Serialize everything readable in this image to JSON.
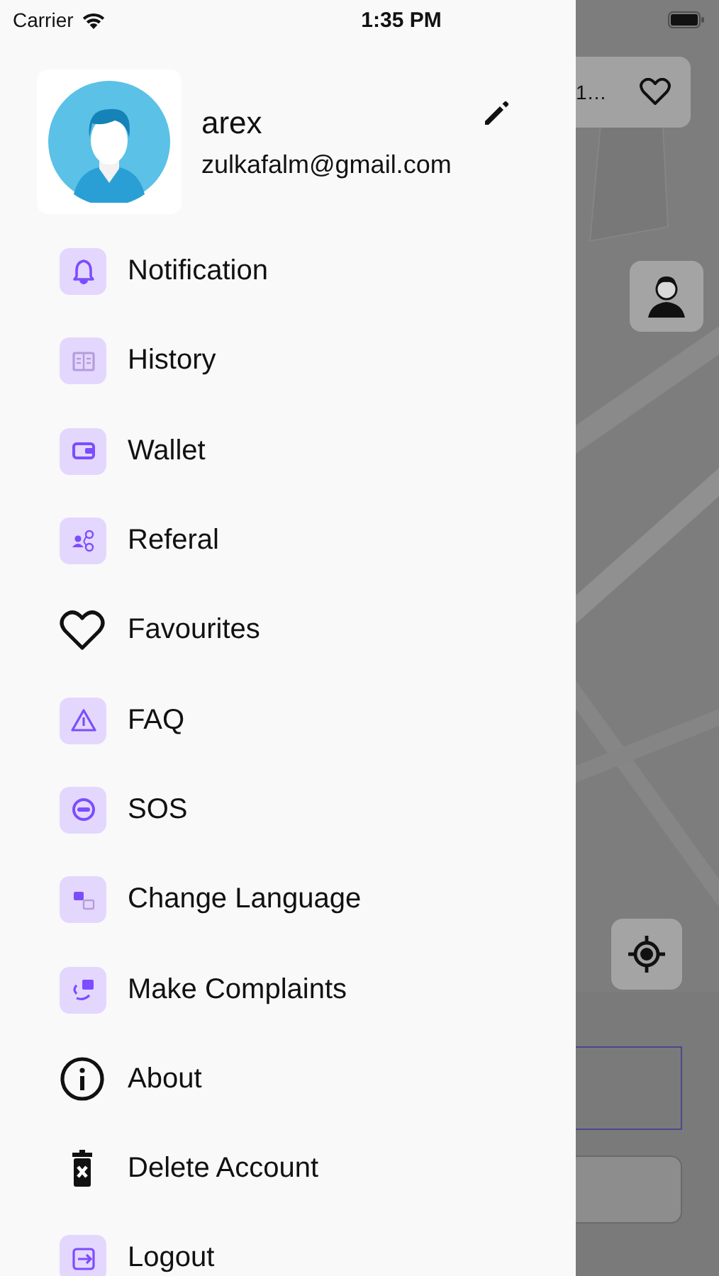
{
  "status_bar": {
    "carrier": "Carrier",
    "time": "1:35 PM"
  },
  "profile": {
    "name": "arex",
    "email": "zulkafalm@gmail.com"
  },
  "menu": [
    {
      "label": "Notification",
      "kind": "tile"
    },
    {
      "label": "History",
      "kind": "tile"
    },
    {
      "label": "Wallet",
      "kind": "tile"
    },
    {
      "label": "Referal",
      "kind": "tile"
    },
    {
      "label": "Favourites",
      "kind": "plain"
    },
    {
      "label": "FAQ",
      "kind": "tile"
    },
    {
      "label": "SOS",
      "kind": "tile"
    },
    {
      "label": "Change Language",
      "kind": "tile"
    },
    {
      "label": "Make Complaints",
      "kind": "tile"
    },
    {
      "label": "About",
      "kind": "plain"
    },
    {
      "label": "Delete Account",
      "kind": "plain"
    },
    {
      "label": "Logout",
      "kind": "tile"
    }
  ],
  "map_card": {
    "text": "1…"
  }
}
